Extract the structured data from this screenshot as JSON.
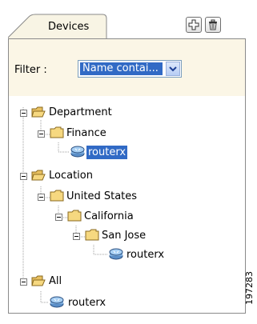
{
  "tab": {
    "label": "Devices"
  },
  "toolbar": {
    "add_icon": "add-icon",
    "delete_icon": "trash-icon"
  },
  "filter": {
    "label": "Filter :",
    "selected_value": "Name contai..."
  },
  "tree": {
    "department": {
      "label": "Department"
    },
    "finance": {
      "label": "Finance"
    },
    "finance_router": {
      "label": "routerx"
    },
    "location": {
      "label": "Location"
    },
    "united_states": {
      "label": "United States"
    },
    "california": {
      "label": "California"
    },
    "san_jose": {
      "label": "San Jose"
    },
    "san_jose_router": {
      "label": "routerx"
    },
    "all": {
      "label": "All"
    },
    "all_router": {
      "label": "routerx"
    }
  },
  "figure_id": "197283",
  "colors": {
    "selection": "#316ac5",
    "panel_bg": "#fbf6e6",
    "tab_bg": "#f2f2f2"
  }
}
